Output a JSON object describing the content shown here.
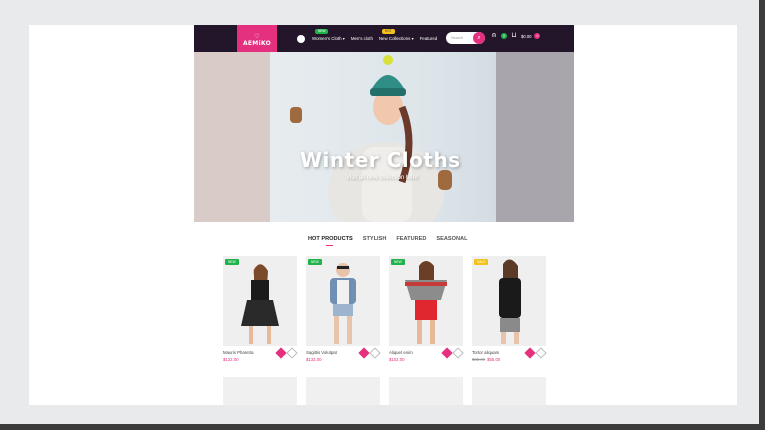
{
  "site": {
    "logo_text": "AEMiKO",
    "nav": [
      {
        "label": "Women's Cloth",
        "badge": "NEW",
        "badge_color": "#21b34b",
        "has_dropdown": true
      },
      {
        "label": "Men's cloth",
        "badge": "",
        "has_dropdown": false
      },
      {
        "label": "New Collections",
        "badge": "HOT",
        "badge_color": "#f3c21a",
        "has_dropdown": true
      },
      {
        "label": "Featured",
        "badge": "",
        "has_dropdown": false
      }
    ],
    "search_placeholder": "Search",
    "wishlist_count": "0",
    "cart_total": "$0.00",
    "cart_count": "0",
    "accent_color": "#e5307f",
    "header_color": "#24162a"
  },
  "hero": {
    "title": "Winter Cloths",
    "subtitle": "Visit all new collection here"
  },
  "tabs": [
    "HOT PRODUCTS",
    "STYLISH",
    "FEATURED",
    "SEASONAL"
  ],
  "products": [
    {
      "name": "Mauris Pharetra",
      "price": "$132.00",
      "old_price": "",
      "badge": "NEW"
    },
    {
      "name": "Sagittis Volutpat",
      "price": "$133.00",
      "old_price": "",
      "badge": "NEW"
    },
    {
      "name": "Aliquet enim",
      "price": "$102.00",
      "old_price": "",
      "badge": "NEW"
    },
    {
      "name": "Tortor aliquam",
      "price": "$55.00",
      "old_price": "$62.00",
      "badge": "SALE"
    }
  ]
}
